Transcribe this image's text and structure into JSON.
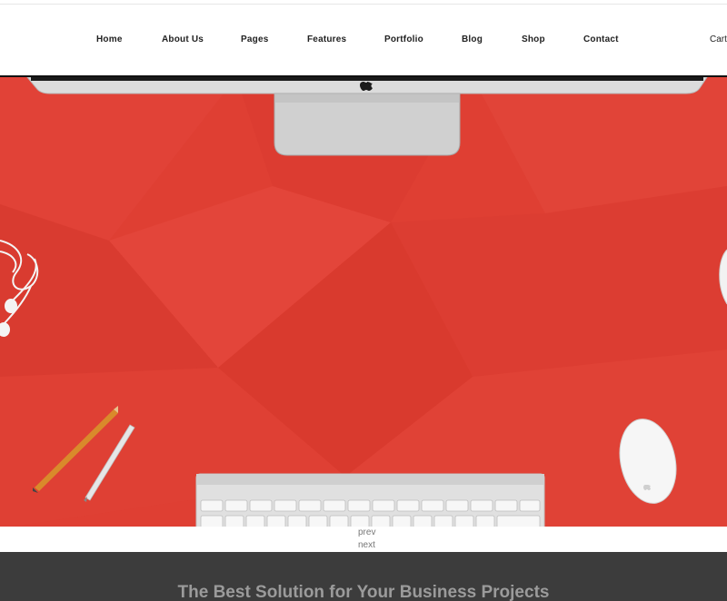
{
  "nav": {
    "items": [
      {
        "label": "Home"
      },
      {
        "label": "About Us"
      },
      {
        "label": "Pages"
      },
      {
        "label": "Features"
      },
      {
        "label": "Portfolio"
      },
      {
        "label": "Blog"
      },
      {
        "label": "Shop"
      },
      {
        "label": "Contact"
      }
    ],
    "cart_label": "Cart"
  },
  "hero": {
    "background_color": "#df3f33"
  },
  "slider": {
    "prev_label": "prev",
    "next_label": "next"
  },
  "band": {
    "title": "The Best Solution for Your Business Projects",
    "background_color": "#3c3c3c"
  }
}
